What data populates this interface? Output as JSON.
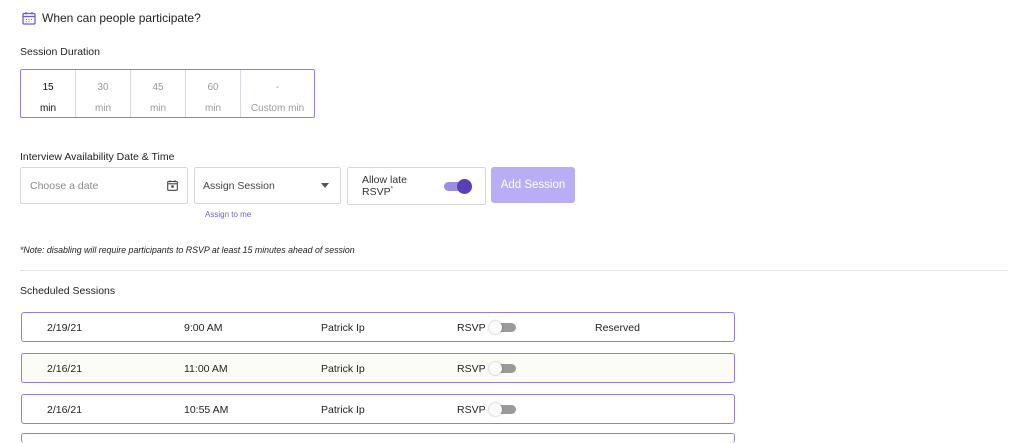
{
  "header": {
    "title": "When can people participate?",
    "icon": "calendar-icon"
  },
  "duration": {
    "label": "Session Duration",
    "options": [
      {
        "value": "15",
        "unit": "min",
        "selected": true
      },
      {
        "value": "30",
        "unit": "min",
        "selected": false
      },
      {
        "value": "45",
        "unit": "min",
        "selected": false
      },
      {
        "value": "60",
        "unit": "min",
        "selected": false
      },
      {
        "value": "-",
        "unit": "Custom min",
        "selected": false
      }
    ]
  },
  "availability": {
    "label": "Interview Availability Date & Time",
    "date_placeholder": "Choose a date",
    "assign_placeholder": "Assign Session",
    "assign_link": "Assign to me",
    "late_rsvp_label": "Allow late RSVP",
    "late_rsvp_marker": "*",
    "late_rsvp_enabled": true,
    "add_button": "Add Session"
  },
  "note": "*Note: disabling will require participants to RSVP at least 15 minutes ahead of session",
  "scheduled": {
    "label": "Scheduled Sessions",
    "rsvp_label": "RSVP",
    "rows": [
      {
        "date": "2/19/21",
        "time": "9:00 AM",
        "name": "Patrick Ip",
        "rsvp": false,
        "status": "Reserved"
      },
      {
        "date": "2/16/21",
        "time": "11:00 AM",
        "name": "Patrick Ip",
        "rsvp": false,
        "status": ""
      },
      {
        "date": "2/16/21",
        "time": "10:55 AM",
        "name": "Patrick Ip",
        "rsvp": false,
        "status": ""
      }
    ]
  },
  "colors": {
    "accent": "#5b3fb8",
    "border_accent": "#8d7fe8",
    "button_disabled": "#b9aef5"
  }
}
